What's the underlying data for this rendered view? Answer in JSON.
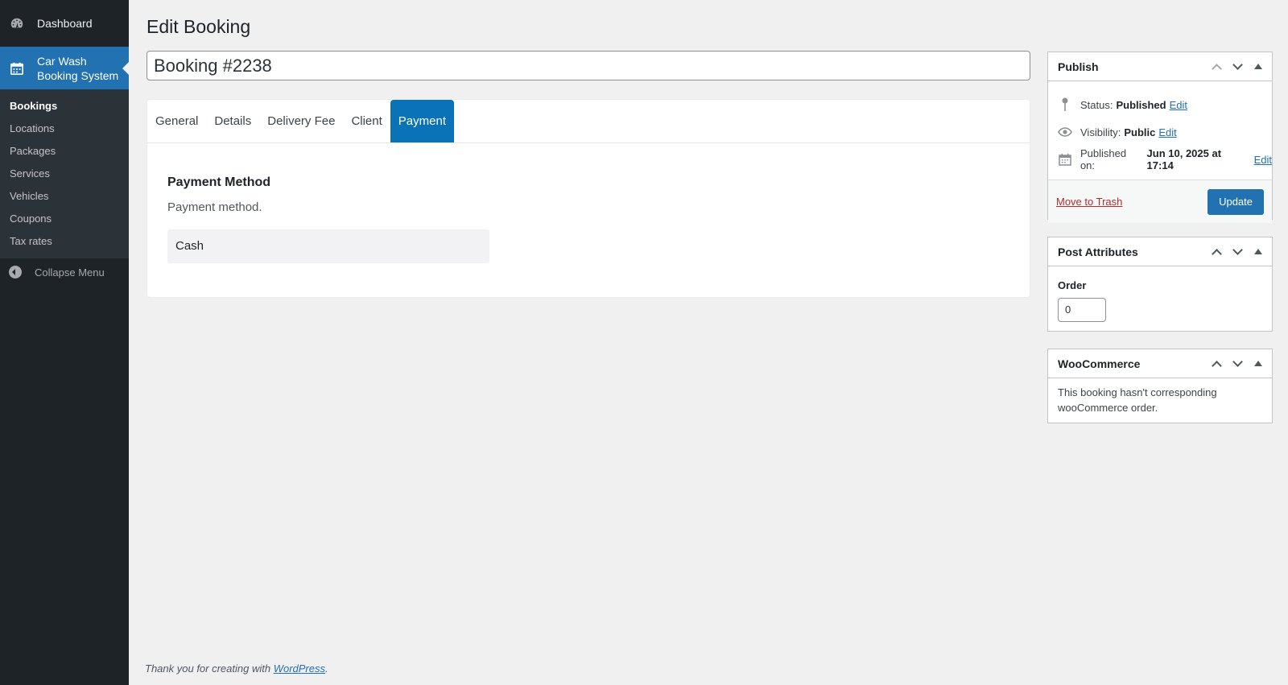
{
  "sidebar": {
    "dashboard": "Dashboard",
    "plugin": "Car Wash Booking System",
    "plugin_line1": "Car Wash",
    "plugin_line2": "Booking System",
    "items": [
      {
        "label": "Bookings",
        "active": true
      },
      {
        "label": "Locations"
      },
      {
        "label": "Packages"
      },
      {
        "label": "Services"
      },
      {
        "label": "Vehicles"
      },
      {
        "label": "Coupons"
      },
      {
        "label": "Tax rates"
      }
    ],
    "collapse": "Collapse Menu"
  },
  "page": {
    "title": "Edit Booking",
    "post_title": "Booking #2238"
  },
  "tabs": {
    "items": [
      "General",
      "Details",
      "Delivery Fee",
      "Client",
      "Payment"
    ],
    "active": "Payment"
  },
  "payment": {
    "field_title": "Payment Method",
    "field_desc": "Payment method.",
    "selected": "Cash"
  },
  "publish": {
    "heading": "Publish",
    "status_label": "Status:",
    "status_value": "Published",
    "visibility_label": "Visibility:",
    "visibility_value": "Public",
    "published_label": "Published on:",
    "published_value": "Jun 10, 2025 at 17:14",
    "edit": "Edit",
    "trash": "Move to Trash",
    "update": "Update"
  },
  "attributes": {
    "heading": "Post Attributes",
    "order_label": "Order",
    "order_value": "0"
  },
  "woocommerce": {
    "heading": "WooCommerce",
    "message": "This booking hasn't corresponding wooCommerce order."
  },
  "footer": {
    "text": "Thank you for creating with",
    "link": "WordPress",
    "period": "."
  },
  "colors": {
    "sidebar_bg": "#1d2327",
    "accent": "#2271b1",
    "tab_active": "#0a73b7",
    "trash": "#b32d2e"
  },
  "icons": [
    "dashboard-icon",
    "calendar-icon",
    "collapse-icon",
    "pin-icon",
    "eye-icon",
    "calendar-small-icon",
    "chevron-up-icon",
    "chevron-down-icon",
    "toggle-arrow-icon"
  ]
}
